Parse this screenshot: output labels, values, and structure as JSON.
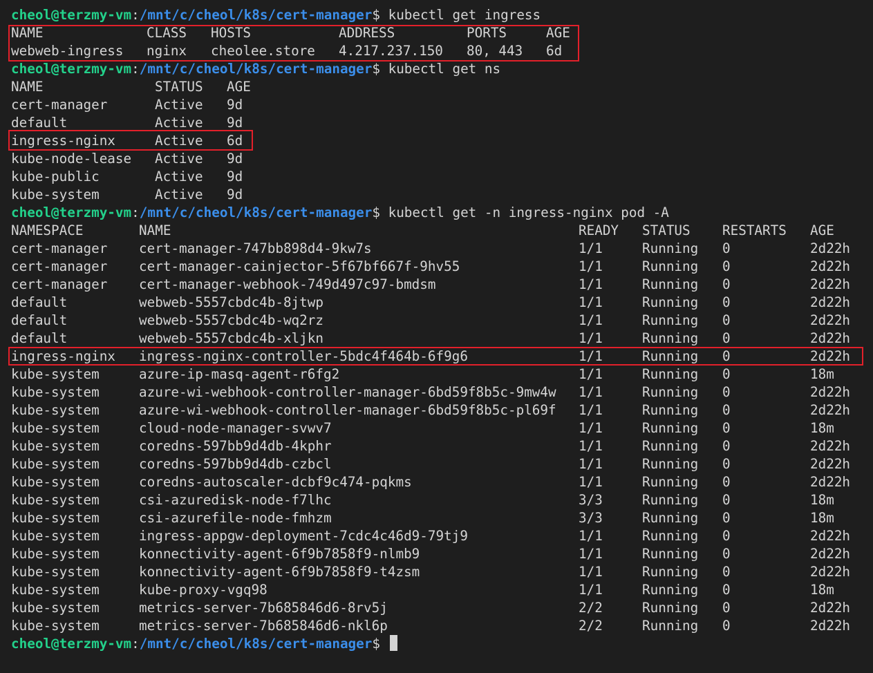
{
  "prompt": {
    "user": "cheol@terzmy-vm",
    "colon": ":",
    "path": "/mnt/c/cheol/k8s/cert-manager",
    "dollar": "$"
  },
  "commands": [
    "kubectl get ingress",
    "kubectl get ns",
    "kubectl get -n ingress-nginx pod -A"
  ],
  "ingress": {
    "headers": [
      "NAME",
      "CLASS",
      "HOSTS",
      "ADDRESS",
      "PORTS",
      "AGE"
    ],
    "rows": [
      [
        "webweb-ingress",
        "nginx",
        "cheolee.store",
        "4.217.237.150",
        "80, 443",
        "6d"
      ]
    ]
  },
  "namespaces": {
    "headers": [
      "NAME",
      "STATUS",
      "AGE"
    ],
    "rows": [
      [
        "cert-manager",
        "Active",
        "9d"
      ],
      [
        "default",
        "Active",
        "9d"
      ],
      [
        "ingress-nginx",
        "Active",
        "6d"
      ],
      [
        "kube-node-lease",
        "Active",
        "9d"
      ],
      [
        "kube-public",
        "Active",
        "9d"
      ],
      [
        "kube-system",
        "Active",
        "9d"
      ]
    ]
  },
  "pods": {
    "headers": [
      "NAMESPACE",
      "NAME",
      "READY",
      "STATUS",
      "RESTARTS",
      "AGE"
    ],
    "rows": [
      [
        "cert-manager",
        "cert-manager-747bb898d4-9kw7s",
        "1/1",
        "Running",
        "0",
        "2d22h"
      ],
      [
        "cert-manager",
        "cert-manager-cainjector-5f67bf667f-9hv55",
        "1/1",
        "Running",
        "0",
        "2d22h"
      ],
      [
        "cert-manager",
        "cert-manager-webhook-749d497c97-bmdsm",
        "1/1",
        "Running",
        "0",
        "2d22h"
      ],
      [
        "default",
        "webweb-5557cbdc4b-8jtwp",
        "1/1",
        "Running",
        "0",
        "2d22h"
      ],
      [
        "default",
        "webweb-5557cbdc4b-wq2rz",
        "1/1",
        "Running",
        "0",
        "2d22h"
      ],
      [
        "default",
        "webweb-5557cbdc4b-xljkn",
        "1/1",
        "Running",
        "0",
        "2d22h"
      ],
      [
        "ingress-nginx",
        "ingress-nginx-controller-5bdc4f464b-6f9g6",
        "1/1",
        "Running",
        "0",
        "2d22h"
      ],
      [
        "kube-system",
        "azure-ip-masq-agent-r6fg2",
        "1/1",
        "Running",
        "0",
        "18m"
      ],
      [
        "kube-system",
        "azure-wi-webhook-controller-manager-6bd59f8b5c-9mw4w",
        "1/1",
        "Running",
        "0",
        "2d22h"
      ],
      [
        "kube-system",
        "azure-wi-webhook-controller-manager-6bd59f8b5c-pl69f",
        "1/1",
        "Running",
        "0",
        "2d22h"
      ],
      [
        "kube-system",
        "cloud-node-manager-svwv7",
        "1/1",
        "Running",
        "0",
        "18m"
      ],
      [
        "kube-system",
        "coredns-597bb9d4db-4kphr",
        "1/1",
        "Running",
        "0",
        "2d22h"
      ],
      [
        "kube-system",
        "coredns-597bb9d4db-czbcl",
        "1/1",
        "Running",
        "0",
        "2d22h"
      ],
      [
        "kube-system",
        "coredns-autoscaler-dcbf9c474-pqkms",
        "1/1",
        "Running",
        "0",
        "2d22h"
      ],
      [
        "kube-system",
        "csi-azuredisk-node-f7lhc",
        "3/3",
        "Running",
        "0",
        "18m"
      ],
      [
        "kube-system",
        "csi-azurefile-node-fmhzm",
        "3/3",
        "Running",
        "0",
        "18m"
      ],
      [
        "kube-system",
        "ingress-appgw-deployment-7cdc4c46d9-79tj9",
        "1/1",
        "Running",
        "0",
        "2d22h"
      ],
      [
        "kube-system",
        "konnectivity-agent-6f9b7858f9-nlmb9",
        "1/1",
        "Running",
        "0",
        "2d22h"
      ],
      [
        "kube-system",
        "konnectivity-agent-6f9b7858f9-t4zsm",
        "1/1",
        "Running",
        "0",
        "2d22h"
      ],
      [
        "kube-system",
        "kube-proxy-vgq98",
        "1/1",
        "Running",
        "0",
        "18m"
      ],
      [
        "kube-system",
        "metrics-server-7b685846d6-8rv5j",
        "2/2",
        "Running",
        "0",
        "2d22h"
      ],
      [
        "kube-system",
        "metrics-server-7b685846d6-nkl6p",
        "2/2",
        "Running",
        "0",
        "2d22h"
      ]
    ]
  },
  "colors": {
    "background": "#1e1e1e",
    "text": "#d4d4d4",
    "prompt_user": "#23d18b",
    "prompt_path": "#3b8eea",
    "highlight": "#e3202a"
  }
}
